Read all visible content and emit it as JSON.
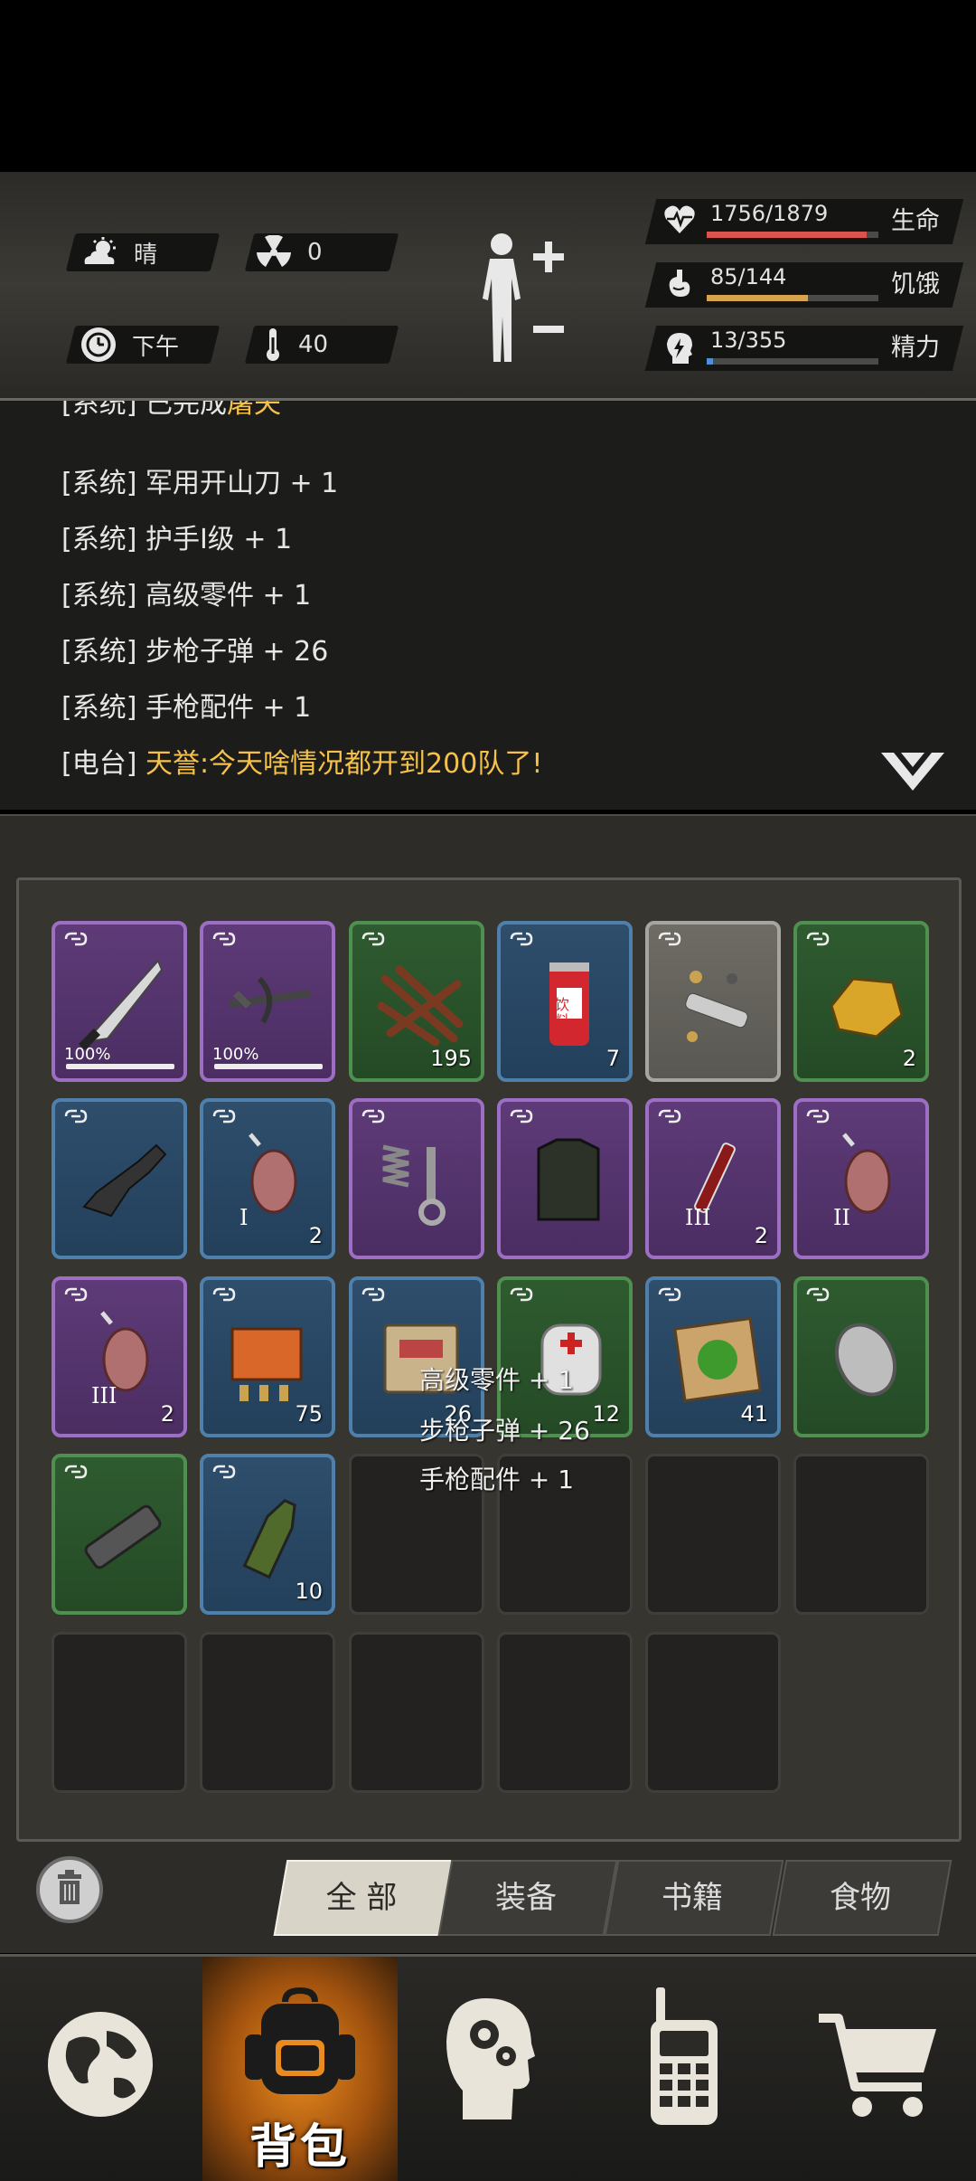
{
  "status": {
    "weather": "晴",
    "radiation": "0",
    "time_of_day": "下午",
    "temperature": "40",
    "stats": [
      {
        "icon": "heart-pulse-icon",
        "value": "1756/1879",
        "label": "生命",
        "fraction": 0.934,
        "color": "#d9534f"
      },
      {
        "icon": "stomach-icon",
        "value": "85/144",
        "label": "饥饿",
        "fraction": 0.59,
        "color": "#d6a44c"
      },
      {
        "icon": "head-bolt-icon",
        "value": "13/355",
        "label": "精力",
        "fraction": 0.037,
        "color": "#4f8fd6"
      }
    ]
  },
  "log": {
    "cut_line": {
      "prefix": "[系统] 已完成",
      "highlight": "屠夫"
    },
    "lines": [
      "[系统] 军用开山刀 + 1",
      "[系统] 护手I级 + 1",
      "[系统] 高级零件 + 1",
      "[系统] 步枪子弹 + 26",
      "[系统] 手枪配件 + 1"
    ],
    "radio": {
      "prefix": "[电台] ",
      "speaker": "天誉",
      "message": ":今天啥情况都开到200队了!"
    }
  },
  "inventory": {
    "items": [
      {
        "name": "machete",
        "rarity": "purple",
        "durability": "100%"
      },
      {
        "name": "crossbow",
        "rarity": "purple",
        "durability": "100%"
      },
      {
        "name": "wood-sticks",
        "rarity": "green",
        "count": "195"
      },
      {
        "name": "soda-can",
        "rarity": "blue",
        "count": "7",
        "can_text": "饮料"
      },
      {
        "name": "scrap-metal",
        "rarity": "gray",
        "count": ""
      },
      {
        "name": "gold-ore",
        "rarity": "green",
        "count": "2"
      },
      {
        "name": "gun-part",
        "rarity": "blue",
        "count": ""
      },
      {
        "name": "meat-I",
        "rarity": "blue",
        "count": "2",
        "tier": "I"
      },
      {
        "name": "springs-bolts",
        "rarity": "purple",
        "count": ""
      },
      {
        "name": "armor-vest",
        "rarity": "purple",
        "count": ""
      },
      {
        "name": "syringe-III",
        "rarity": "purple",
        "count": "2",
        "tier": "III"
      },
      {
        "name": "meat-II",
        "rarity": "purple",
        "count": "",
        "tier": "II"
      },
      {
        "name": "meat-III",
        "rarity": "purple",
        "count": "2",
        "tier": "III"
      },
      {
        "name": "shotgun-shells",
        "rarity": "blue",
        "count": "75"
      },
      {
        "name": "ammo-box",
        "rarity": "blue",
        "count": "26"
      },
      {
        "name": "bandage-roll",
        "rarity": "green",
        "count": "12"
      },
      {
        "name": "herb-map",
        "rarity": "blue",
        "count": "41"
      },
      {
        "name": "coin",
        "rarity": "green",
        "count": ""
      },
      {
        "name": "muzzle-brake",
        "rarity": "green",
        "count": ""
      },
      {
        "name": "molotov",
        "rarity": "blue",
        "count": "10"
      }
    ],
    "empty_slots": 9,
    "toasts": [
      "高级零件 + 1",
      "步枪子弹 + 26",
      "手枪配件 + 1"
    ]
  },
  "tabs": [
    "全 部",
    "装备",
    "书籍",
    "食物"
  ],
  "active_tab": 0,
  "nav": {
    "active_label": "背包",
    "active_index": 1,
    "items": [
      "globe-icon",
      "backpack-icon",
      "brain-head-icon",
      "walkie-talkie-icon",
      "shopping-cart-icon"
    ]
  }
}
